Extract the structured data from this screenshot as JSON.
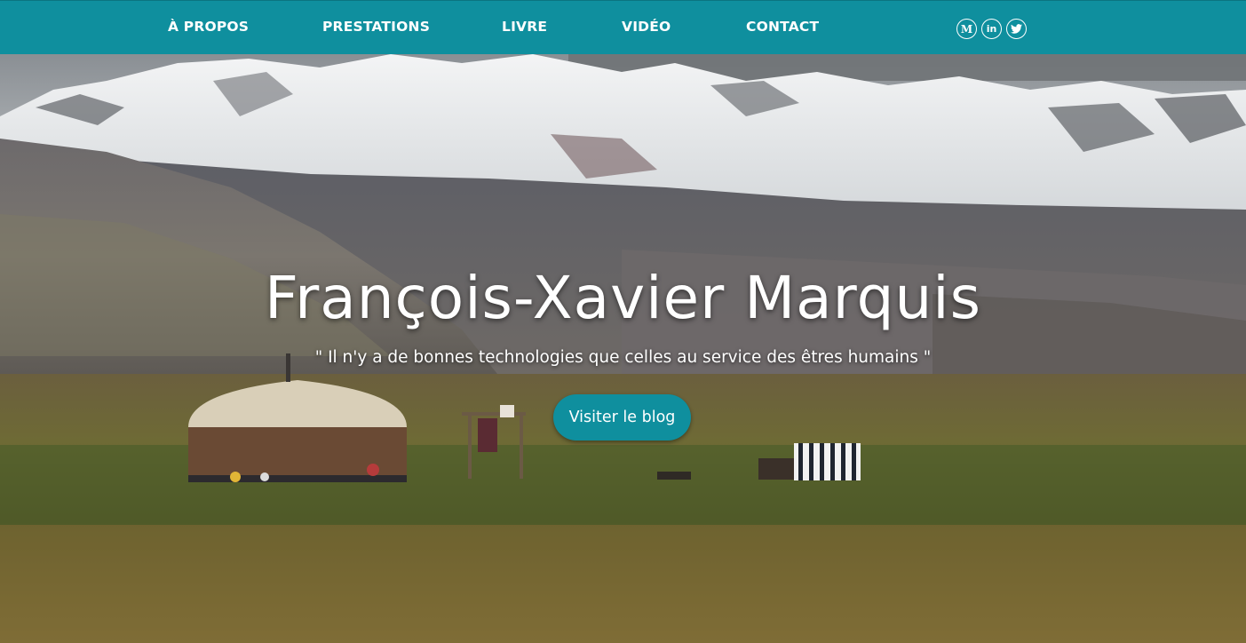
{
  "nav": {
    "items": [
      {
        "label": "À PROPOS"
      },
      {
        "label": "PRESTATIONS"
      },
      {
        "label": "LIVRE"
      },
      {
        "label": "VIDÉO"
      },
      {
        "label": "CONTACT"
      }
    ],
    "social": [
      {
        "icon": "medium-icon",
        "glyph": "M"
      },
      {
        "icon": "linkedin-icon",
        "glyph": "in"
      },
      {
        "icon": "twitter-icon"
      }
    ]
  },
  "hero": {
    "title": "François-Xavier Marquis",
    "quote": "\" Il n'y a de bonnes technologies que celles au service des êtres humains \"",
    "cta_label": "Visiter le blog"
  },
  "colors": {
    "accent": "#0f8f9e",
    "text": "#ffffff"
  }
}
